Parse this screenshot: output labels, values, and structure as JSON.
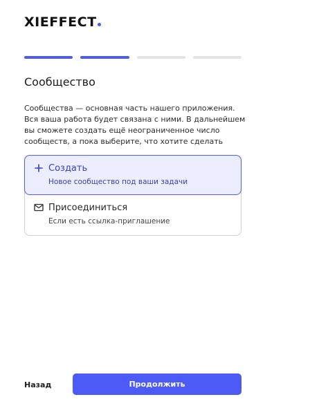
{
  "brand": {
    "logo_text": "XIEFFECT",
    "accent": "#4c5af6"
  },
  "stepper": {
    "total_steps": 4,
    "completed_steps": 2
  },
  "page": {
    "title": "Сообщество",
    "description": "Сообщества — основная часть нашего приложения. Вся ваша работа будет связана с ними. В дальнейшем вы сможете создать ещё неограниченное число сообществ, а пока выберите, что хотите сделать"
  },
  "options": [
    {
      "label": "Создать",
      "subtitle": "Новое сообщество под ваши задачи",
      "icon": "plus-icon",
      "selected": true
    },
    {
      "label": "Присоединиться",
      "subtitle": "Если есть ссылка-приглашение",
      "icon": "mail-icon",
      "selected": false
    }
  ],
  "actions": {
    "back_label": "Назад",
    "continue_label": "Продолжить"
  }
}
